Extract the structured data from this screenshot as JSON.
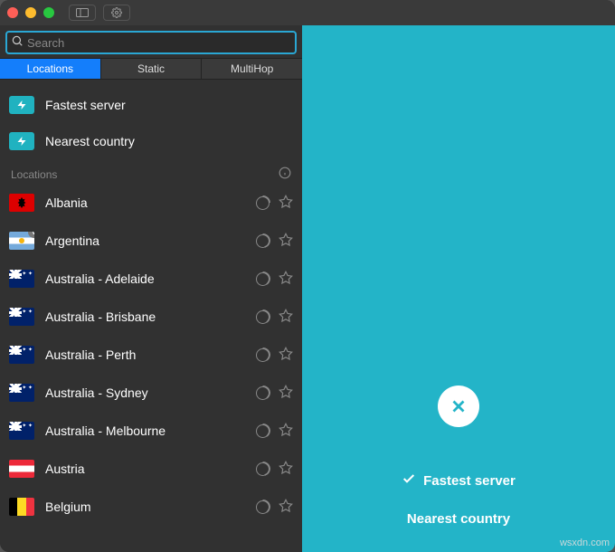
{
  "titlebar": {
    "buttons": [
      "sidebar-toggle",
      "settings"
    ]
  },
  "search": {
    "placeholder": "Search",
    "value": ""
  },
  "tabs": [
    {
      "id": "locations",
      "label": "Locations",
      "active": true
    },
    {
      "id": "static",
      "label": "Static",
      "active": false
    },
    {
      "id": "multihop",
      "label": "MultiHop",
      "active": false
    }
  ],
  "quick_picks": [
    {
      "id": "fastest",
      "label": "Fastest server",
      "icon": "bolt-icon"
    },
    {
      "id": "nearest",
      "label": "Nearest country",
      "icon": "bolt-icon"
    }
  ],
  "section": {
    "title": "Locations"
  },
  "locations": [
    {
      "name": "Albania",
      "flag": "al",
      "load_pct": 25,
      "badge": null
    },
    {
      "name": "Argentina",
      "flag": "ar",
      "load_pct": 45,
      "badge": "V"
    },
    {
      "name": "Australia - Adelaide",
      "flag": "au",
      "load_pct": 40,
      "badge": null
    },
    {
      "name": "Australia - Brisbane",
      "flag": "au",
      "load_pct": 40,
      "badge": null
    },
    {
      "name": "Australia - Perth",
      "flag": "au",
      "load_pct": 40,
      "badge": null
    },
    {
      "name": "Australia - Sydney",
      "flag": "au",
      "load_pct": 40,
      "badge": null
    },
    {
      "name": "Australia - Melbourne",
      "flag": "au",
      "load_pct": 40,
      "badge": null
    },
    {
      "name": "Austria",
      "flag": "at",
      "load_pct": 45,
      "badge": null
    },
    {
      "name": "Belgium",
      "flag": "be",
      "load_pct": 40,
      "badge": null
    }
  ],
  "main": {
    "selected": "Fastest server",
    "secondary": "Nearest country"
  },
  "watermark": "wsxdn.com",
  "colors": {
    "accent": "#23b4c8",
    "tab_active": "#147efb"
  }
}
